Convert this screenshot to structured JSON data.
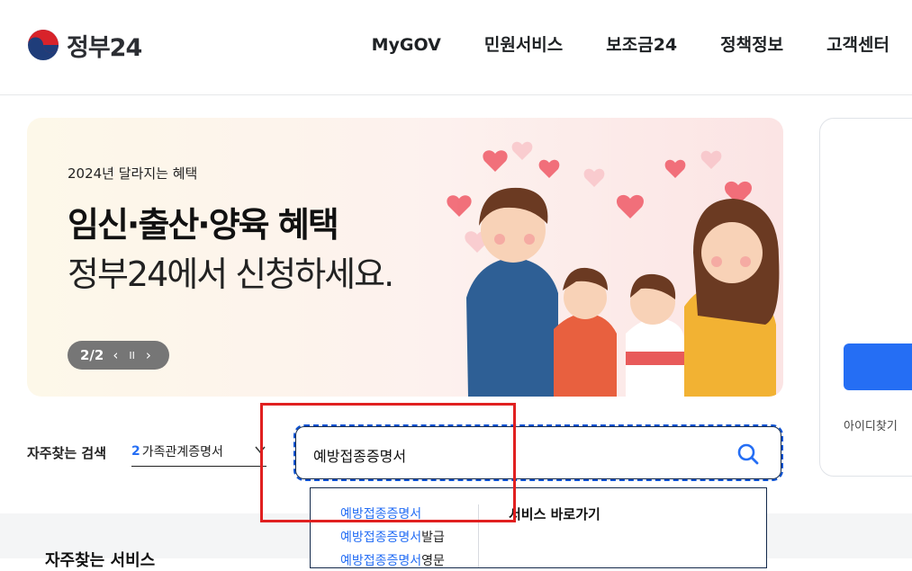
{
  "header": {
    "logo_text": "정부24",
    "nav": [
      "MyGOV",
      "민원서비스",
      "보조금24",
      "정책정보",
      "고객센터"
    ]
  },
  "banner": {
    "subtitle": "2024년 달라지는 혜택",
    "title": "임신·출산·양육 혜택",
    "description": "정부24에서 신청하세요.",
    "pager": "2/2",
    "prev_symbol": "‹",
    "pause_symbol": "II",
    "next_symbol": "›"
  },
  "side_panel": {
    "link": "아이디찾기"
  },
  "frequent_search": {
    "label": "자주찾는 검색",
    "rank": "2",
    "term": "가족관계증명서"
  },
  "search": {
    "value": "예방접종증명서"
  },
  "suggestions": {
    "items": [
      {
        "match": "예방접종증명서",
        "rest": ""
      },
      {
        "match": "예방접종증명서",
        "rest": "발급"
      },
      {
        "match": "예방접종증명서",
        "rest": "영문"
      }
    ],
    "shortcut_title": "서비스 바로가기"
  },
  "lower": {
    "title": "자주찾는 서비스"
  },
  "colors": {
    "accent": "#256ef4",
    "focus_border": "#0b50d0",
    "annotation": "#e02020"
  }
}
